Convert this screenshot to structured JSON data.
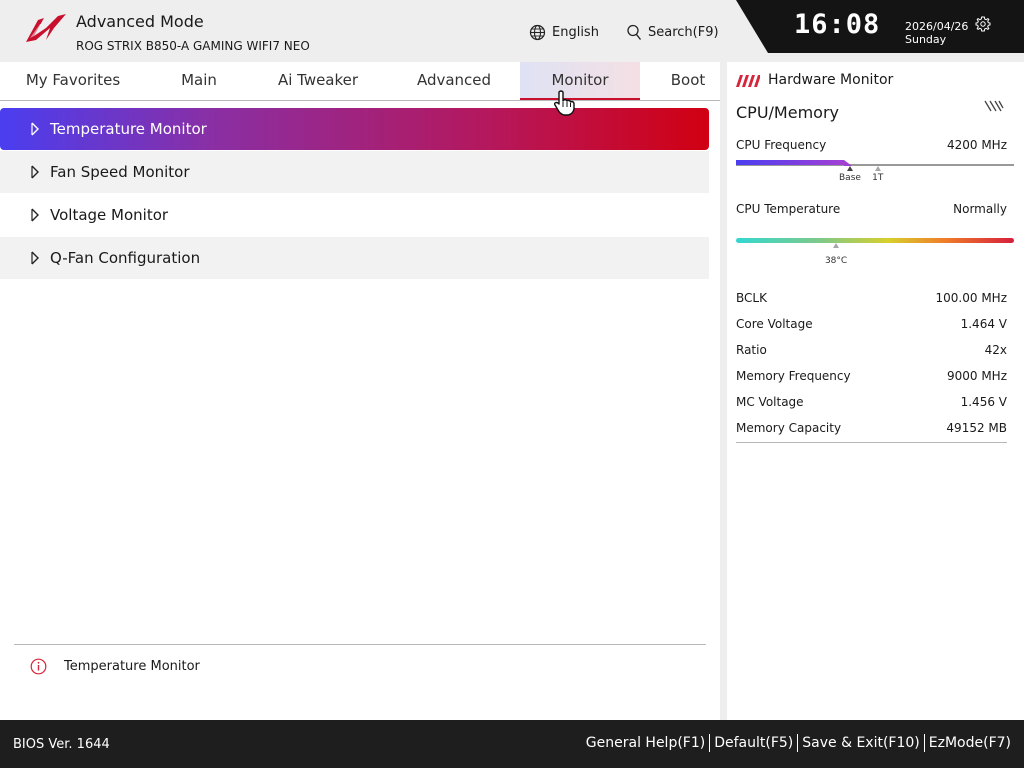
{
  "header": {
    "mode_title": "Advanced Mode",
    "board_name": "ROG STRIX B850-A GAMING WIFI7 NEO",
    "language_label": "English",
    "search_label": "Search(F9)",
    "time": "16:08",
    "date": "2026/04/26",
    "day": "Sunday",
    "icons": {
      "language": "globe-icon",
      "search": "search-icon",
      "settings": "gear-icon",
      "logo": "rog-logo-icon"
    }
  },
  "tabs": [
    {
      "label": "My Favorites",
      "active": false
    },
    {
      "label": "Main",
      "active": false
    },
    {
      "label": "Ai Tweaker",
      "active": false
    },
    {
      "label": "Advanced",
      "active": false
    },
    {
      "label": "Monitor",
      "active": true
    },
    {
      "label": "Boot",
      "active": false
    }
  ],
  "menu": {
    "items": [
      {
        "label": "Temperature Monitor",
        "selected": true
      },
      {
        "label": "Fan Speed Monitor",
        "selected": false
      },
      {
        "label": "Voltage Monitor",
        "selected": false
      },
      {
        "label": "Q-Fan Configuration",
        "selected": false
      }
    ]
  },
  "help": {
    "text": "Temperature Monitor",
    "icon": "info-icon"
  },
  "hardware_monitor": {
    "title": "Hardware Monitor",
    "section": "CPU/Memory",
    "cpu_frequency": {
      "label": "CPU Frequency",
      "value": "4200 MHz",
      "fill_fraction": 0.41,
      "markers": [
        {
          "label": "Base",
          "fraction": 0.41
        },
        {
          "label": "1T",
          "fraction": 0.51
        }
      ]
    },
    "cpu_temperature": {
      "label": "CPU Temperature",
      "value": "Normally",
      "reading": "38°C",
      "marker_fraction": 0.36
    },
    "rows": [
      {
        "label": "BCLK",
        "value": "100.00 MHz"
      },
      {
        "label": "Core Voltage",
        "value": "1.464 V"
      },
      {
        "label": "Ratio",
        "value": "42x"
      },
      {
        "label": "Memory Frequency",
        "value": "9000 MHz"
      },
      {
        "label": "MC Voltage",
        "value": "1.456 V"
      },
      {
        "label": "Memory Capacity",
        "value": "49152 MB"
      }
    ]
  },
  "footer": {
    "bios_version": "BIOS Ver. 1644",
    "links": [
      {
        "label": "General Help(F1)"
      },
      {
        "label": "Default(F5)"
      },
      {
        "label": "Save & Exit(F10)"
      },
      {
        "label": "EzMode(F7)"
      }
    ]
  },
  "colors": {
    "accent_red": "#c8102e",
    "selected_gradient_start": "#4a3ef0",
    "selected_gradient_end": "#d10012"
  }
}
